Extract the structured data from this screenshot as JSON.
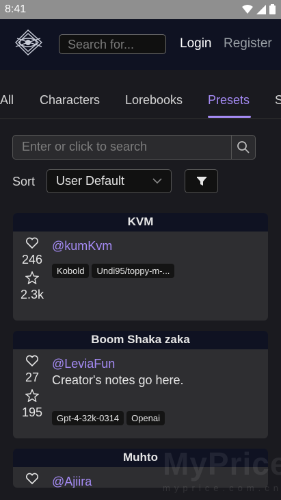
{
  "status_bar": {
    "time": "8:41"
  },
  "header": {
    "search_placeholder": "Search for...",
    "login_label": "Login",
    "register_label": "Register"
  },
  "tabs": [
    {
      "label": "All"
    },
    {
      "label": "Characters"
    },
    {
      "label": "Lorebooks"
    },
    {
      "label": "Presets"
    },
    {
      "label": "S"
    }
  ],
  "active_tab": "Presets",
  "search": {
    "placeholder": "Enter or click to search"
  },
  "sort": {
    "label": "Sort",
    "selected": "User Default"
  },
  "cards": [
    {
      "title": "KVM",
      "creator": "@kumKvm",
      "likes": "246",
      "stars": "2.3k",
      "notes": "",
      "tags": [
        "Kobold",
        "Undi95/toppy-m-..."
      ]
    },
    {
      "title": "Boom Shaka zaka",
      "creator": "@LeviaFun",
      "likes": "27",
      "stars": "195",
      "notes": "Creator's notes go here.",
      "tags": [
        "Gpt-4-32k-0314",
        "Openai"
      ]
    },
    {
      "title": "Muhto",
      "creator": "@Ajiira",
      "likes": "",
      "stars": "",
      "notes": "",
      "tags": []
    }
  ],
  "watermark": {
    "main": "MyPrice",
    "sub": "myprice.com.cn"
  },
  "colors": {
    "accent": "#a58bf5",
    "header_bg": "#0f1222",
    "card_bg": "#2e2e31",
    "page_bg": "#1a1a1f"
  }
}
